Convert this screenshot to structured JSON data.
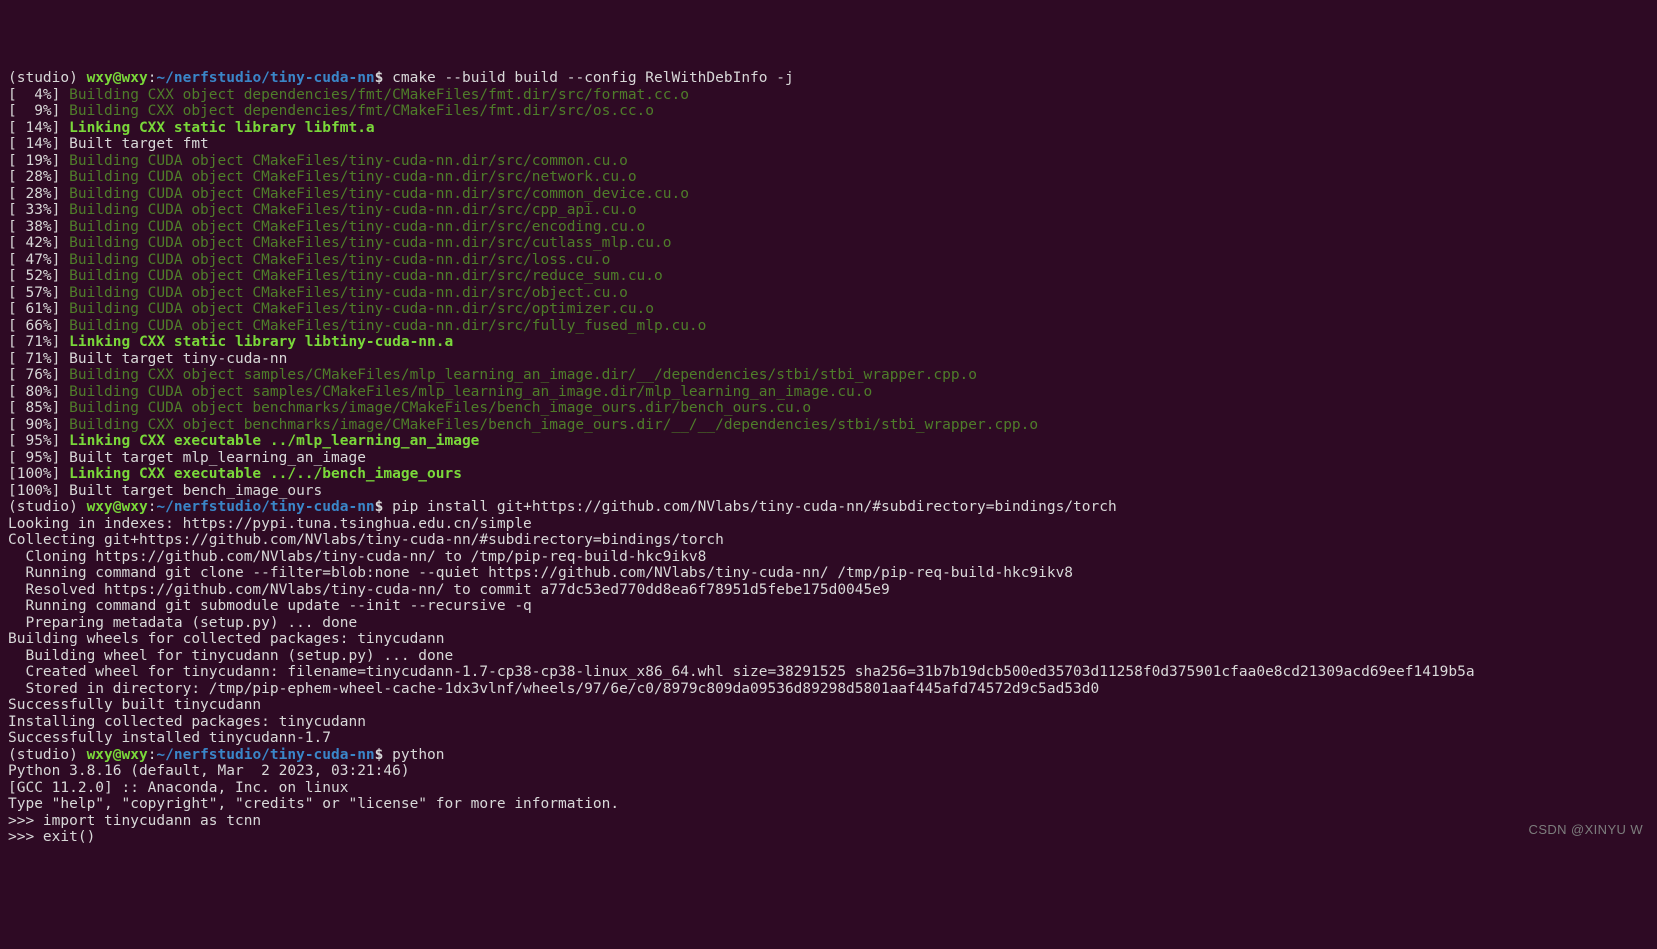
{
  "prompt1": {
    "env": "(studio) ",
    "user": "wxy@wxy",
    "colon": ":",
    "path": "~/nerfstudio/tiny-cuda-nn",
    "dollar": "$ ",
    "cmd": "cmake --build build --config RelWithDebInfo -j"
  },
  "cmake": [
    {
      "p": "[  4%] ",
      "c": "build",
      "t": "Building CXX object dependencies/fmt/CMakeFiles/fmt.dir/src/format.cc.o"
    },
    {
      "p": "[  9%] ",
      "c": "build",
      "t": "Building CXX object dependencies/fmt/CMakeFiles/fmt.dir/src/os.cc.o"
    },
    {
      "p": "[ 14%] ",
      "c": "linkbold",
      "t": "Linking CXX static library libfmt.a"
    },
    {
      "p": "[ 14%] ",
      "c": "plain",
      "t": "Built target fmt"
    },
    {
      "p": "[ 19%] ",
      "c": "build",
      "t": "Building CUDA object CMakeFiles/tiny-cuda-nn.dir/src/common.cu.o"
    },
    {
      "p": "[ 28%] ",
      "c": "build",
      "t": "Building CUDA object CMakeFiles/tiny-cuda-nn.dir/src/network.cu.o"
    },
    {
      "p": "[ 28%] ",
      "c": "build",
      "t": "Building CUDA object CMakeFiles/tiny-cuda-nn.dir/src/common_device.cu.o"
    },
    {
      "p": "[ 33%] ",
      "c": "build",
      "t": "Building CUDA object CMakeFiles/tiny-cuda-nn.dir/src/cpp_api.cu.o"
    },
    {
      "p": "[ 38%] ",
      "c": "build",
      "t": "Building CUDA object CMakeFiles/tiny-cuda-nn.dir/src/encoding.cu.o"
    },
    {
      "p": "[ 42%] ",
      "c": "build",
      "t": "Building CUDA object CMakeFiles/tiny-cuda-nn.dir/src/cutlass_mlp.cu.o"
    },
    {
      "p": "[ 47%] ",
      "c": "build",
      "t": "Building CUDA object CMakeFiles/tiny-cuda-nn.dir/src/loss.cu.o"
    },
    {
      "p": "[ 52%] ",
      "c": "build",
      "t": "Building CUDA object CMakeFiles/tiny-cuda-nn.dir/src/reduce_sum.cu.o"
    },
    {
      "p": "[ 57%] ",
      "c": "build",
      "t": "Building CUDA object CMakeFiles/tiny-cuda-nn.dir/src/object.cu.o"
    },
    {
      "p": "[ 61%] ",
      "c": "build",
      "t": "Building CUDA object CMakeFiles/tiny-cuda-nn.dir/src/optimizer.cu.o"
    },
    {
      "p": "[ 66%] ",
      "c": "build",
      "t": "Building CUDA object CMakeFiles/tiny-cuda-nn.dir/src/fully_fused_mlp.cu.o"
    },
    {
      "p": "[ 71%] ",
      "c": "linkbold",
      "t": "Linking CXX static library libtiny-cuda-nn.a"
    },
    {
      "p": "[ 71%] ",
      "c": "plain",
      "t": "Built target tiny-cuda-nn"
    },
    {
      "p": "[ 76%] ",
      "c": "build",
      "t": "Building CXX object samples/CMakeFiles/mlp_learning_an_image.dir/__/dependencies/stbi/stbi_wrapper.cpp.o"
    },
    {
      "p": "[ 80%] ",
      "c": "build",
      "t": "Building CUDA object samples/CMakeFiles/mlp_learning_an_image.dir/mlp_learning_an_image.cu.o"
    },
    {
      "p": "[ 85%] ",
      "c": "build",
      "t": "Building CUDA object benchmarks/image/CMakeFiles/bench_image_ours.dir/bench_ours.cu.o"
    },
    {
      "p": "[ 90%] ",
      "c": "build",
      "t": "Building CXX object benchmarks/image/CMakeFiles/bench_image_ours.dir/__/__/dependencies/stbi/stbi_wrapper.cpp.o"
    },
    {
      "p": "[ 95%] ",
      "c": "linkbold",
      "t": "Linking CXX executable ../mlp_learning_an_image"
    },
    {
      "p": "[ 95%] ",
      "c": "plain",
      "t": "Built target mlp_learning_an_image"
    },
    {
      "p": "[100%] ",
      "c": "linkbold",
      "t": "Linking CXX executable ../../bench_image_ours"
    },
    {
      "p": "[100%] ",
      "c": "plain",
      "t": "Built target bench_image_ours"
    }
  ],
  "prompt2": {
    "env": "(studio) ",
    "user": "wxy@wxy",
    "colon": ":",
    "path": "~/nerfstudio/tiny-cuda-nn",
    "dollar": "$ ",
    "cmd": "pip install git+https://github.com/NVlabs/tiny-cuda-nn/#subdirectory=bindings/torch"
  },
  "pip": [
    "Looking in indexes: https://pypi.tuna.tsinghua.edu.cn/simple",
    "Collecting git+https://github.com/NVlabs/tiny-cuda-nn/#subdirectory=bindings/torch",
    "  Cloning https://github.com/NVlabs/tiny-cuda-nn/ to /tmp/pip-req-build-hkc9ikv8",
    "  Running command git clone --filter=blob:none --quiet https://github.com/NVlabs/tiny-cuda-nn/ /tmp/pip-req-build-hkc9ikv8",
    "  Resolved https://github.com/NVlabs/tiny-cuda-nn/ to commit a77dc53ed770dd8ea6f78951d5febe175d0045e9",
    "  Running command git submodule update --init --recursive -q",
    "  Preparing metadata (setup.py) ... done",
    "Building wheels for collected packages: tinycudann",
    "  Building wheel for tinycudann (setup.py) ... done",
    "  Created wheel for tinycudann: filename=tinycudann-1.7-cp38-cp38-linux_x86_64.whl size=38291525 sha256=31b7b19dcb500ed35703d11258f0d375901cfaa0e8cd21309acd69eef1419b5a",
    "  Stored in directory: /tmp/pip-ephem-wheel-cache-1dx3vlnf/wheels/97/6e/c0/8979c809da09536d89298d5801aaf445afd74572d9c5ad53d0",
    "Successfully built tinycudann",
    "Installing collected packages: tinycudann",
    "Successfully installed tinycudann-1.7"
  ],
  "prompt3": {
    "env": "(studio) ",
    "user": "wxy@wxy",
    "colon": ":",
    "path": "~/nerfstudio/tiny-cuda-nn",
    "dollar": "$ ",
    "cmd": "python"
  },
  "pyinfo": [
    "Python 3.8.16 (default, Mar  2 2023, 03:21:46) ",
    "[GCC 11.2.0] :: Anaconda, Inc. on linux",
    "Type \"help\", \"copyright\", \"credits\" or \"license\" for more information."
  ],
  "repl": [
    {
      "p": ">>> ",
      "t": "import tinycudann as tcnn"
    },
    {
      "p": ">>> ",
      "t": "exit()"
    }
  ],
  "watermark": "CSDN @XINYU W"
}
